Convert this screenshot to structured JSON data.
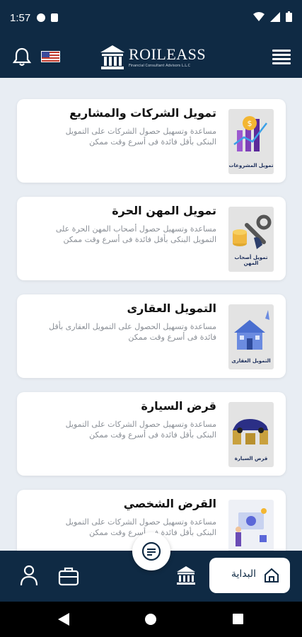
{
  "status_bar": {
    "time": "1:57"
  },
  "header": {
    "brand_name": "ROILEASS",
    "brand_tagline": "Financial Consultant Advisors L.L.C"
  },
  "services": [
    {
      "title": "تمويل الشركات والمشاريع",
      "description": "مساعدة وتسهيل حصول الشركات على التمويل البنكى بأقل فائدة فى أسرع وقت ممكن",
      "image_label": "تمويل المشروعات"
    },
    {
      "title": "تمويل المهن الحرة",
      "description": "مساعدة وتسهيل حصول أصحاب المهن الحرة على التمويل البنكى بأقل فائدة فى أسرع وقت ممكن",
      "image_label": "تمويل أصحاب المهن"
    },
    {
      "title": "التمويل العقارى",
      "description": "مساعدة وتسهيل الحصول على التمويل العقارى بأقل فائدة فى أسرع وقت ممكن",
      "image_label": "التمويل العقارى"
    },
    {
      "title": "قرض السيارة",
      "description": "مساعدة وتسهيل حصول الشركات على التمويل البنكى بأقل فائدة فى أسرع وقت ممكن",
      "image_label": "قرض السيارة"
    },
    {
      "title": "القرض الشخصي",
      "description": "مساعدة وتسهيل حصول الشركات على التمويل البنكى بأقل فائدة فى أسرع وقت ممكن",
      "image_label": ""
    }
  ],
  "bottom_nav": {
    "home_label": "البداية"
  },
  "colors": {
    "primary": "#0f2a44",
    "background": "#e8edf3",
    "card": "#ffffff",
    "desc_text": "#8a8f96"
  },
  "icons": [
    "bell-icon",
    "us-flag-icon",
    "bank-logo-icon",
    "hamburger-menu-icon",
    "chat-icon",
    "profile-icon",
    "briefcase-icon",
    "bank-icon",
    "home-icon"
  ]
}
